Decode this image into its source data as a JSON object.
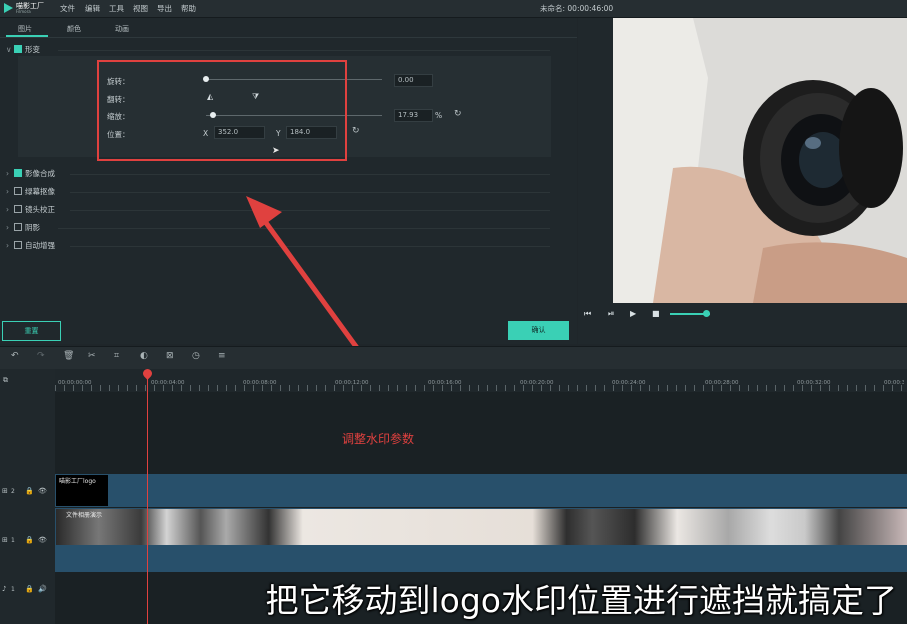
{
  "app": {
    "logo_text": "喵影工厂",
    "logo_sub": "Filmora"
  },
  "menu": [
    "文件",
    "编辑",
    "工具",
    "视图",
    "导出",
    "帮助"
  ],
  "doc_title": "未命名: 00:00:46:00",
  "tabs": [
    "图片",
    "颜色",
    "动画"
  ],
  "sections": [
    {
      "label": "形变",
      "checked": true,
      "expanded": true
    },
    {
      "label": "影像合成",
      "checked": true,
      "expanded": false
    },
    {
      "label": "绿幕抠像",
      "checked": false,
      "expanded": false
    },
    {
      "label": "镜头校正",
      "checked": false,
      "expanded": false
    },
    {
      "label": "阴影",
      "checked": false,
      "expanded": false
    },
    {
      "label": "自动增强",
      "checked": false,
      "expanded": false
    }
  ],
  "transform": {
    "rotate_label": "旋转：",
    "rotate_value": "0.00",
    "rotate_level": 0,
    "flip_label": "翻转：",
    "scale_label": "缩放：",
    "scale_value": "17.93",
    "scale_unit": "%",
    "scale_level": 0.04,
    "position_label": "位置：",
    "x_label": "X",
    "x_value": "352.0",
    "y_label": "Y",
    "y_value": "184.0"
  },
  "buttons": {
    "reset": "重置",
    "ok": "确认"
  },
  "timeline": {
    "ticks": [
      "00:00:00:00",
      "00:00:04:00",
      "00:00:08:00",
      "00:00:12:00",
      "00:00:16:00",
      "00:00:20:00",
      "00:00:24:00",
      "00:00:28:00",
      "00:00:32:00",
      "00:00:36:00"
    ],
    "track2_label": "2",
    "track1_label": "1",
    "audio_label": "1",
    "logo_clip_label": "喵影工厂logo",
    "video_clip_label": "文件相册演示"
  },
  "annotation": "调整水印参数",
  "subtitle": "把它移动到logo水印位置进行遮挡就搞定了",
  "colors": {
    "accent": "#3ad0b5",
    "annotation_red": "#e0413f",
    "track_blue": "#28506b"
  }
}
